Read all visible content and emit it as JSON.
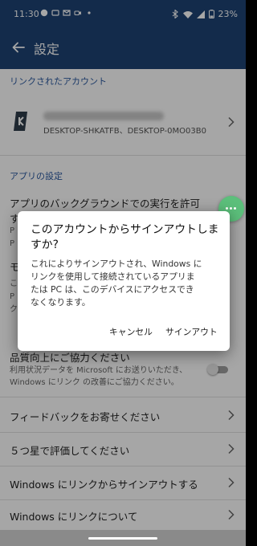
{
  "status": {
    "time": "11:30",
    "battery": "23%"
  },
  "appbar": {
    "title": "設定"
  },
  "linked": {
    "header": "リンクされたアカウント",
    "devices": "DESKTOP-SHKATFB、DESKTOP-0MO03B0"
  },
  "app_settings": {
    "header": "アプリの設定",
    "background_run": "アプリのバックグラウンドでの実行を許可",
    "background_run_cont": "す",
    "rows_hidden": [
      "P",
      "P",
      "モ",
      "こ",
      "P",
      "ク"
    ]
  },
  "quality": {
    "title": "品質向上にご協力ください",
    "desc1": "利用状況データを Microsoft にお送りいただき、",
    "desc2": "Windows にリンク の改善にご協力ください。"
  },
  "menu": [
    {
      "label": "フィードバックをお寄せください"
    },
    {
      "label": "５つ星で評価してください"
    },
    {
      "label": "Windows にリンクからサインアウトする"
    },
    {
      "label": "Windows にリンクについて"
    }
  ],
  "dialog": {
    "title_line1": "このアカウントからサインアウトしま",
    "title_line2": "すか?",
    "body_line1": "これによりサインアウトされ、Windows に",
    "body_line2": "リンクを使用して接続されているアプリま",
    "body_line3": "たは PC は、このデバイスにアクセスでき",
    "body_line4": "なくなります。",
    "cancel": "キャンセル",
    "confirm": "サインアウト"
  },
  "icons": {
    "back": "arrow-left-icon",
    "chevron": "chevron-right-icon",
    "fab": "more-dots-icon"
  },
  "colors": {
    "appbar": "#1e4374",
    "accent": "#2c5aa0",
    "fab": "#5cbf7b"
  }
}
